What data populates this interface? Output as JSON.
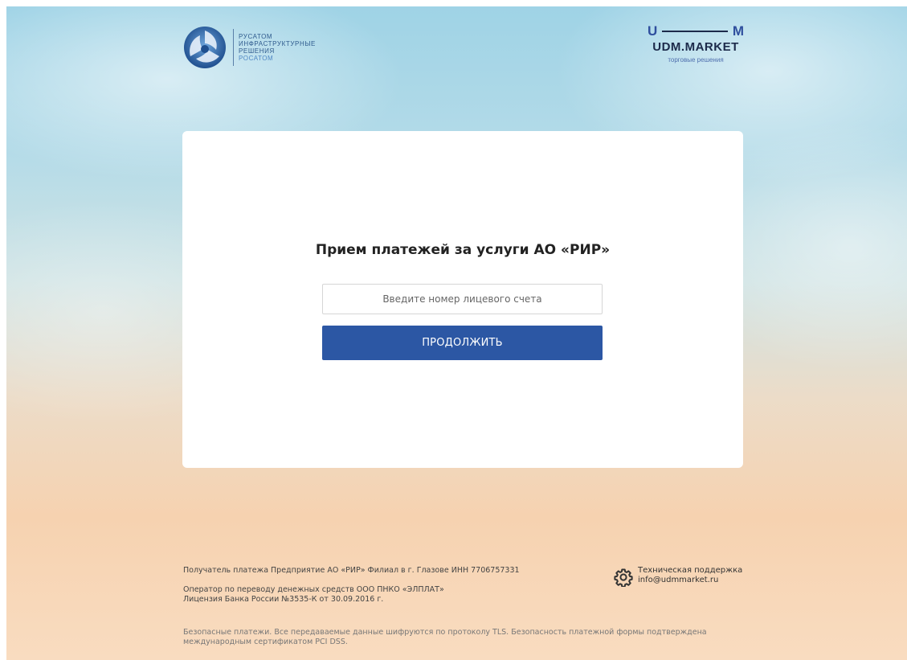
{
  "header": {
    "rosatom": {
      "line1": "РУСАТОМ",
      "line2": "ИНФРАСТРУКТУРНЫЕ",
      "line3": "РЕШЕНИЯ",
      "line4": "РОСАТОМ"
    },
    "udm": {
      "left_letter": "U",
      "right_letter": "M",
      "name": "UDM.MARKET",
      "tagline": "торговые решения"
    }
  },
  "form": {
    "title": "Прием платежей за услуги АО «РИР»",
    "account_input": {
      "placeholder": "Введите номер лицевого счета",
      "value": ""
    },
    "continue_label": "ПРОДОЛЖИТЬ"
  },
  "footer": {
    "recipient": "Получатель платежа Предприятие АО «РИР» Филиал в г. Глазове ИНН 7706757331",
    "operator": "Оператор по переводу денежных средств ООО ПНКО «ЭЛПЛАТ»",
    "license": "Лицензия Банка России №3535-К от 30.09.2016 г.",
    "security": "Безопасные платежи. Все передаваемые данные шифруются по протоколу TLS. Безопасность платежной формы подтверждена международным сертификатом PCI DSS.",
    "support_title": "Техническая поддержка",
    "support_email": "info@udmmarket.ru"
  },
  "colors": {
    "button": "#2c57a4",
    "brand_blue": "#2f5b8e"
  },
  "icons": {
    "rosatom": "rosatom-emblem-icon",
    "support": "gear-icon"
  }
}
